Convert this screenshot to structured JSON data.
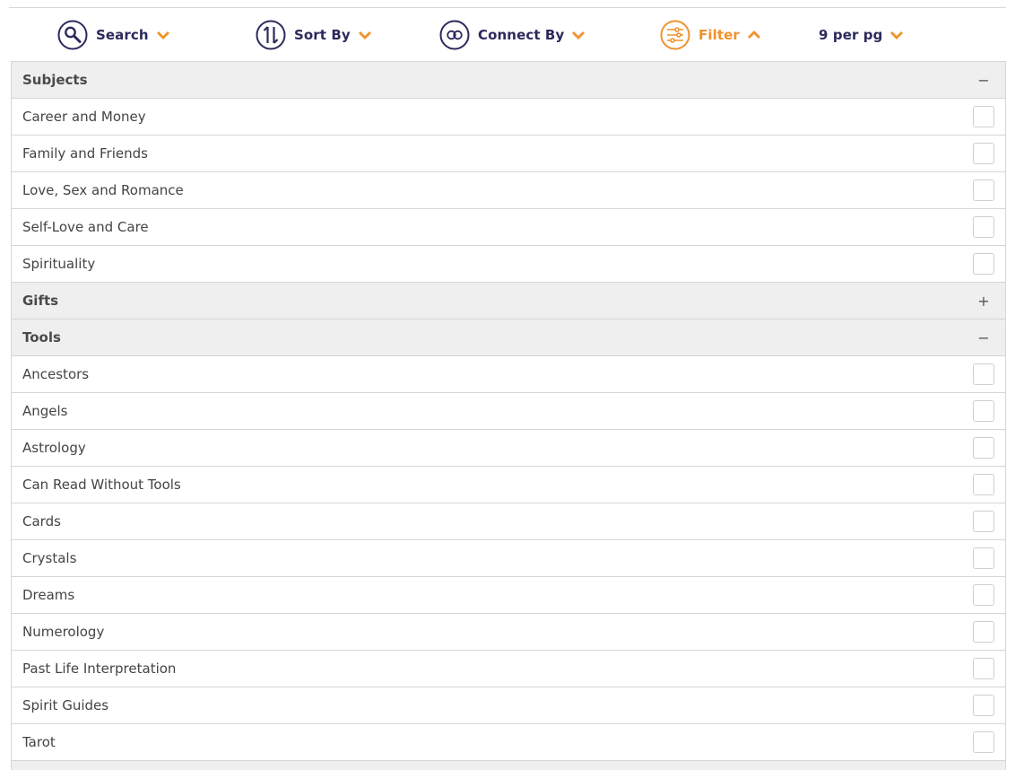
{
  "toolbar": {
    "search": {
      "label": "Search",
      "icon": "search-icon",
      "chevron": "chevron-down-icon"
    },
    "sort": {
      "label": "Sort By",
      "icon": "sort-arrows-icon",
      "chevron": "chevron-down-icon"
    },
    "connect": {
      "label": "Connect By",
      "icon": "infinity-icon",
      "chevron": "chevron-down-icon"
    },
    "filter": {
      "label": "Filter",
      "icon": "sliders-icon",
      "chevron": "chevron-up-icon",
      "active": true
    },
    "per_page": {
      "label": "9 per pg",
      "chevron": "chevron-down-icon"
    }
  },
  "colors": {
    "navy": "#2b2a5c",
    "orange": "#f0922b",
    "header_bg": "#efefef",
    "border": "#d6d6d6"
  },
  "filters": {
    "subjects": {
      "title": "Subjects",
      "toggle": "−",
      "expanded": true,
      "items": [
        "Career and Money",
        "Family and Friends",
        "Love, Sex and Romance",
        "Self-Love and Care",
        "Spirituality"
      ]
    },
    "gifts": {
      "title": "Gifts",
      "toggle": "+",
      "expanded": false
    },
    "tools": {
      "title": "Tools",
      "toggle": "−",
      "expanded": true,
      "items": [
        "Ancestors",
        "Angels",
        "Astrology",
        "Can Read Without Tools",
        "Cards",
        "Crystals",
        "Dreams",
        "Numerology",
        "Past Life Interpretation",
        "Spirit Guides",
        "Tarot"
      ]
    }
  }
}
